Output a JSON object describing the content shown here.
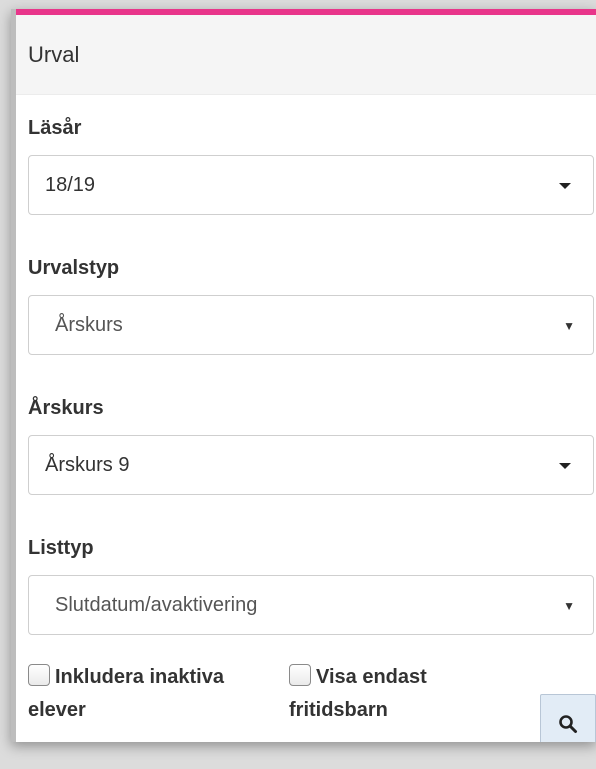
{
  "panel": {
    "title": "Urval",
    "accent_color": "#e8358a"
  },
  "fields": {
    "lasar": {
      "label": "Läsår",
      "value": "18/19"
    },
    "urvalstyp": {
      "label": "Urvalstyp",
      "value": "Årskurs"
    },
    "arskurs": {
      "label": "Årskurs",
      "value": "Årskurs 9"
    },
    "listtyp": {
      "label": "Listtyp",
      "value": "Slutdatum/avaktivering"
    }
  },
  "checkboxes": {
    "include_inactive": {
      "label_line1": "Inkludera inaktiva",
      "label_line2": "elever",
      "checked": false
    },
    "only_fritids": {
      "label_line1": "Visa endast",
      "label_line2": "fritidsbarn",
      "checked": false
    }
  },
  "search_button": {
    "icon": "search-icon"
  }
}
